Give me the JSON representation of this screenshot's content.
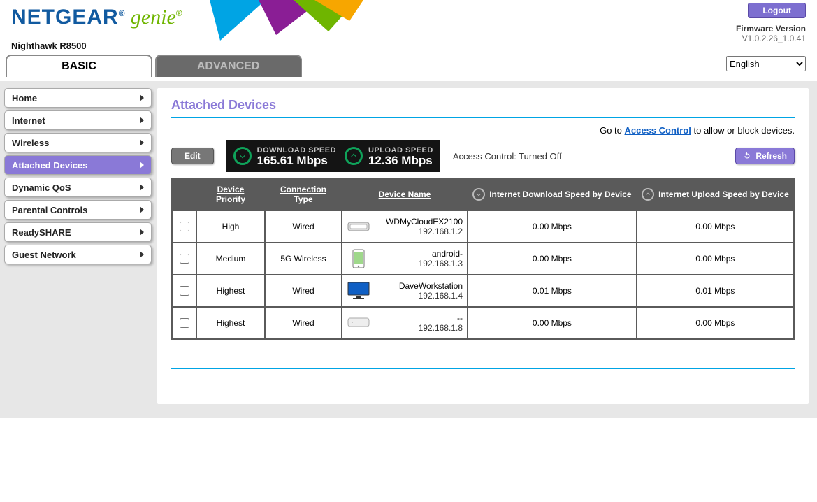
{
  "header": {
    "logo_netgear": "NETGEAR",
    "logo_genie": "genie",
    "device_model": "Nighthawk R8500",
    "logout": "Logout",
    "fw_label": "Firmware Version",
    "fw_version": "V1.0.2.26_1.0.41",
    "language": "English"
  },
  "tabs": {
    "basic": "BASIC",
    "advanced": "ADVANCED"
  },
  "sidebar": {
    "items": [
      {
        "label": "Home",
        "active": false
      },
      {
        "label": "Internet",
        "active": false
      },
      {
        "label": "Wireless",
        "active": false
      },
      {
        "label": "Attached Devices",
        "active": true
      },
      {
        "label": "Dynamic QoS",
        "active": false
      },
      {
        "label": "Parental Controls",
        "active": false
      },
      {
        "label": "ReadySHARE",
        "active": false
      },
      {
        "label": "Guest Network",
        "active": false
      }
    ]
  },
  "page": {
    "title": "Attached Devices",
    "goto_prefix": "Go to ",
    "goto_link": "Access Control",
    "goto_suffix": " to allow or block devices.",
    "edit": "Edit",
    "refresh": "Refresh",
    "download_label": "DOWNLOAD SPEED",
    "download_value": "165.61 Mbps",
    "upload_label": "UPLOAD SPEED",
    "upload_value": "12.36 Mbps",
    "ac_status": "Access Control: Turned Off",
    "columns": {
      "priority": "Device Priority",
      "conn": "Connection Type",
      "name": "Device Name",
      "down": "Internet Download Speed by Device",
      "up": "Internet Upload Speed by Device"
    },
    "devices": [
      {
        "priority": "High",
        "conn": "Wired",
        "name": "WDMyCloudEX2100",
        "ip": "192.168.1.2",
        "down": "0.00 Mbps",
        "up": "0.00 Mbps",
        "icon": "nas"
      },
      {
        "priority": "Medium",
        "conn": "5G Wireless",
        "name": "android-",
        "ip": "192.168.1.3",
        "down": "0.00 Mbps",
        "up": "0.00 Mbps",
        "icon": "phone"
      },
      {
        "priority": "Highest",
        "conn": "Wired",
        "name": "DaveWorkstation",
        "ip": "192.168.1.4",
        "down": "0.01 Mbps",
        "up": "0.01 Mbps",
        "icon": "monitor"
      },
      {
        "priority": "Highest",
        "conn": "Wired",
        "name": "--",
        "ip": "192.168.1.8",
        "down": "0.00 Mbps",
        "up": "0.00 Mbps",
        "icon": "box"
      }
    ]
  }
}
